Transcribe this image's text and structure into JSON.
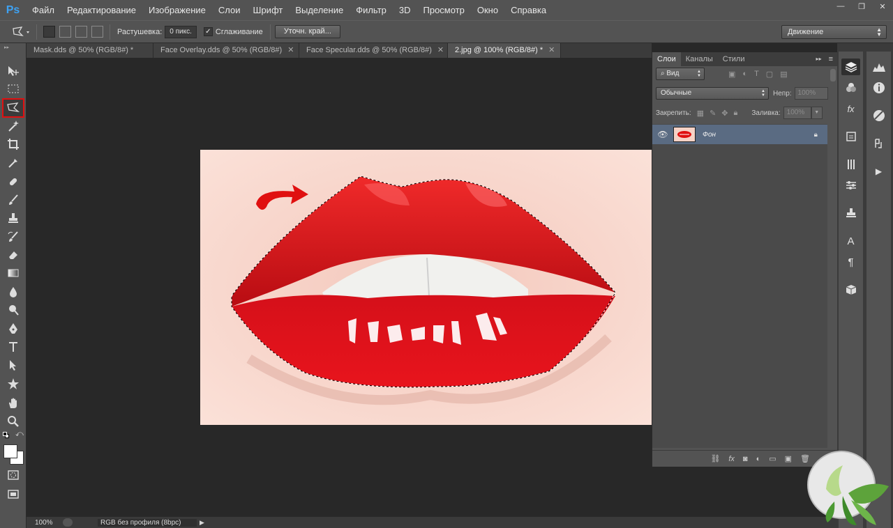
{
  "app": {
    "logo": "Ps"
  },
  "menu": [
    "Файл",
    "Редактирование",
    "Изображение",
    "Слои",
    "Шрифт",
    "Выделение",
    "Фильтр",
    "3D",
    "Просмотр",
    "Окно",
    "Справка"
  ],
  "window_controls": {
    "minimize": "—",
    "restore": "❐",
    "close": "✕"
  },
  "options": {
    "feather_label": "Растушевка:",
    "feather_value": "0 пикс.",
    "antialias_label": "Сглаживание",
    "antialias_checked": true,
    "refine_edge": "Уточн. край...",
    "workspace": "Движение"
  },
  "tabs": [
    {
      "label": "Mask.dds @ 50% (RGB/8#) *",
      "active": false
    },
    {
      "label": "Face Overlay.dds @ 50% (RGB/8#)",
      "active": false
    },
    {
      "label": "Face Specular.dds @ 50% (RGB/8#)",
      "active": false
    },
    {
      "label": "2.jpg @ 100% (RGB/8#) *",
      "active": true
    }
  ],
  "status": {
    "zoom": "100%",
    "doc_info": "RGB без профиля (8bpc)"
  },
  "layers_panel": {
    "tabs": [
      "Слои",
      "Каналы",
      "Стили"
    ],
    "filter_label": "Вид",
    "blend_mode": "Обычные",
    "opacity_label": "Непр:",
    "opacity_value": "100%",
    "lock_label": "Закрепить:",
    "fill_label": "Заливка:",
    "fill_value": "100%",
    "layers": [
      {
        "name": "Фон",
        "visible": true,
        "locked": true,
        "selected": true
      }
    ]
  },
  "colors": {
    "accent_selected_layer": "#5a6b82",
    "active_tool_outline": "#e01010",
    "lips": "#e8141c"
  }
}
